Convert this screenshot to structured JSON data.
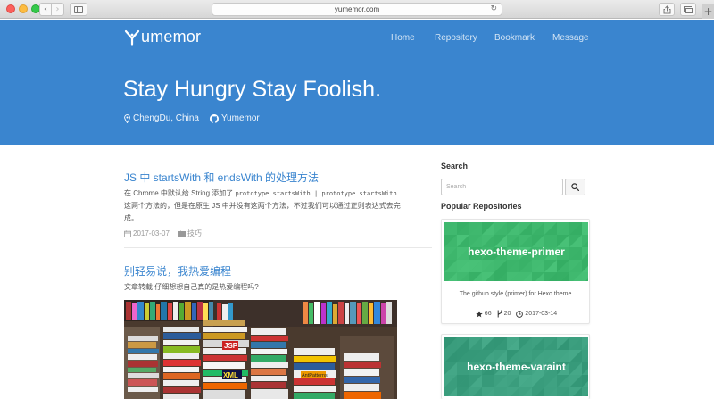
{
  "browser": {
    "url": "yumemor.com"
  },
  "site": {
    "brand": "umemor",
    "nav": [
      "Home",
      "Repository",
      "Bookmark",
      "Message"
    ],
    "hero_title": "Stay Hungry Stay Foolish.",
    "location": "ChengDu, China",
    "github_user": "Yumemor",
    "header_color": "#3a85cf",
    "link_color": "#3a85cf"
  },
  "posts": [
    {
      "title": "JS 中 startsWith 和 endsWith 的处理方法",
      "excerpt_parts": [
        "在 Chrome 中默认给 String 添加了 ",
        "prototype.startsWith | prototype.startsWith",
        " 这两个方法的，但是在原生 JS 中并没有这两个方法，不过我们可以通过正则表达式去完成。"
      ],
      "date": "2017-03-07",
      "category": "技巧"
    },
    {
      "title": "别轻易说，我热爱编程",
      "excerpt": "文章转载 仔细想想自己真的是热爱编程吗?"
    }
  ],
  "sidebar": {
    "search_title": "Search",
    "search_placeholder": "Search",
    "popular_title": "Popular Repositories",
    "repos": [
      {
        "name": "hexo-theme-primer",
        "description": "The github style (primer) for Hexo theme.",
        "stars": "66",
        "forks": "20",
        "updated": "2017-03-14",
        "color": "#3fb86e"
      },
      {
        "name": "hexo-theme-varaint",
        "color": "#3c9f7f"
      }
    ]
  }
}
